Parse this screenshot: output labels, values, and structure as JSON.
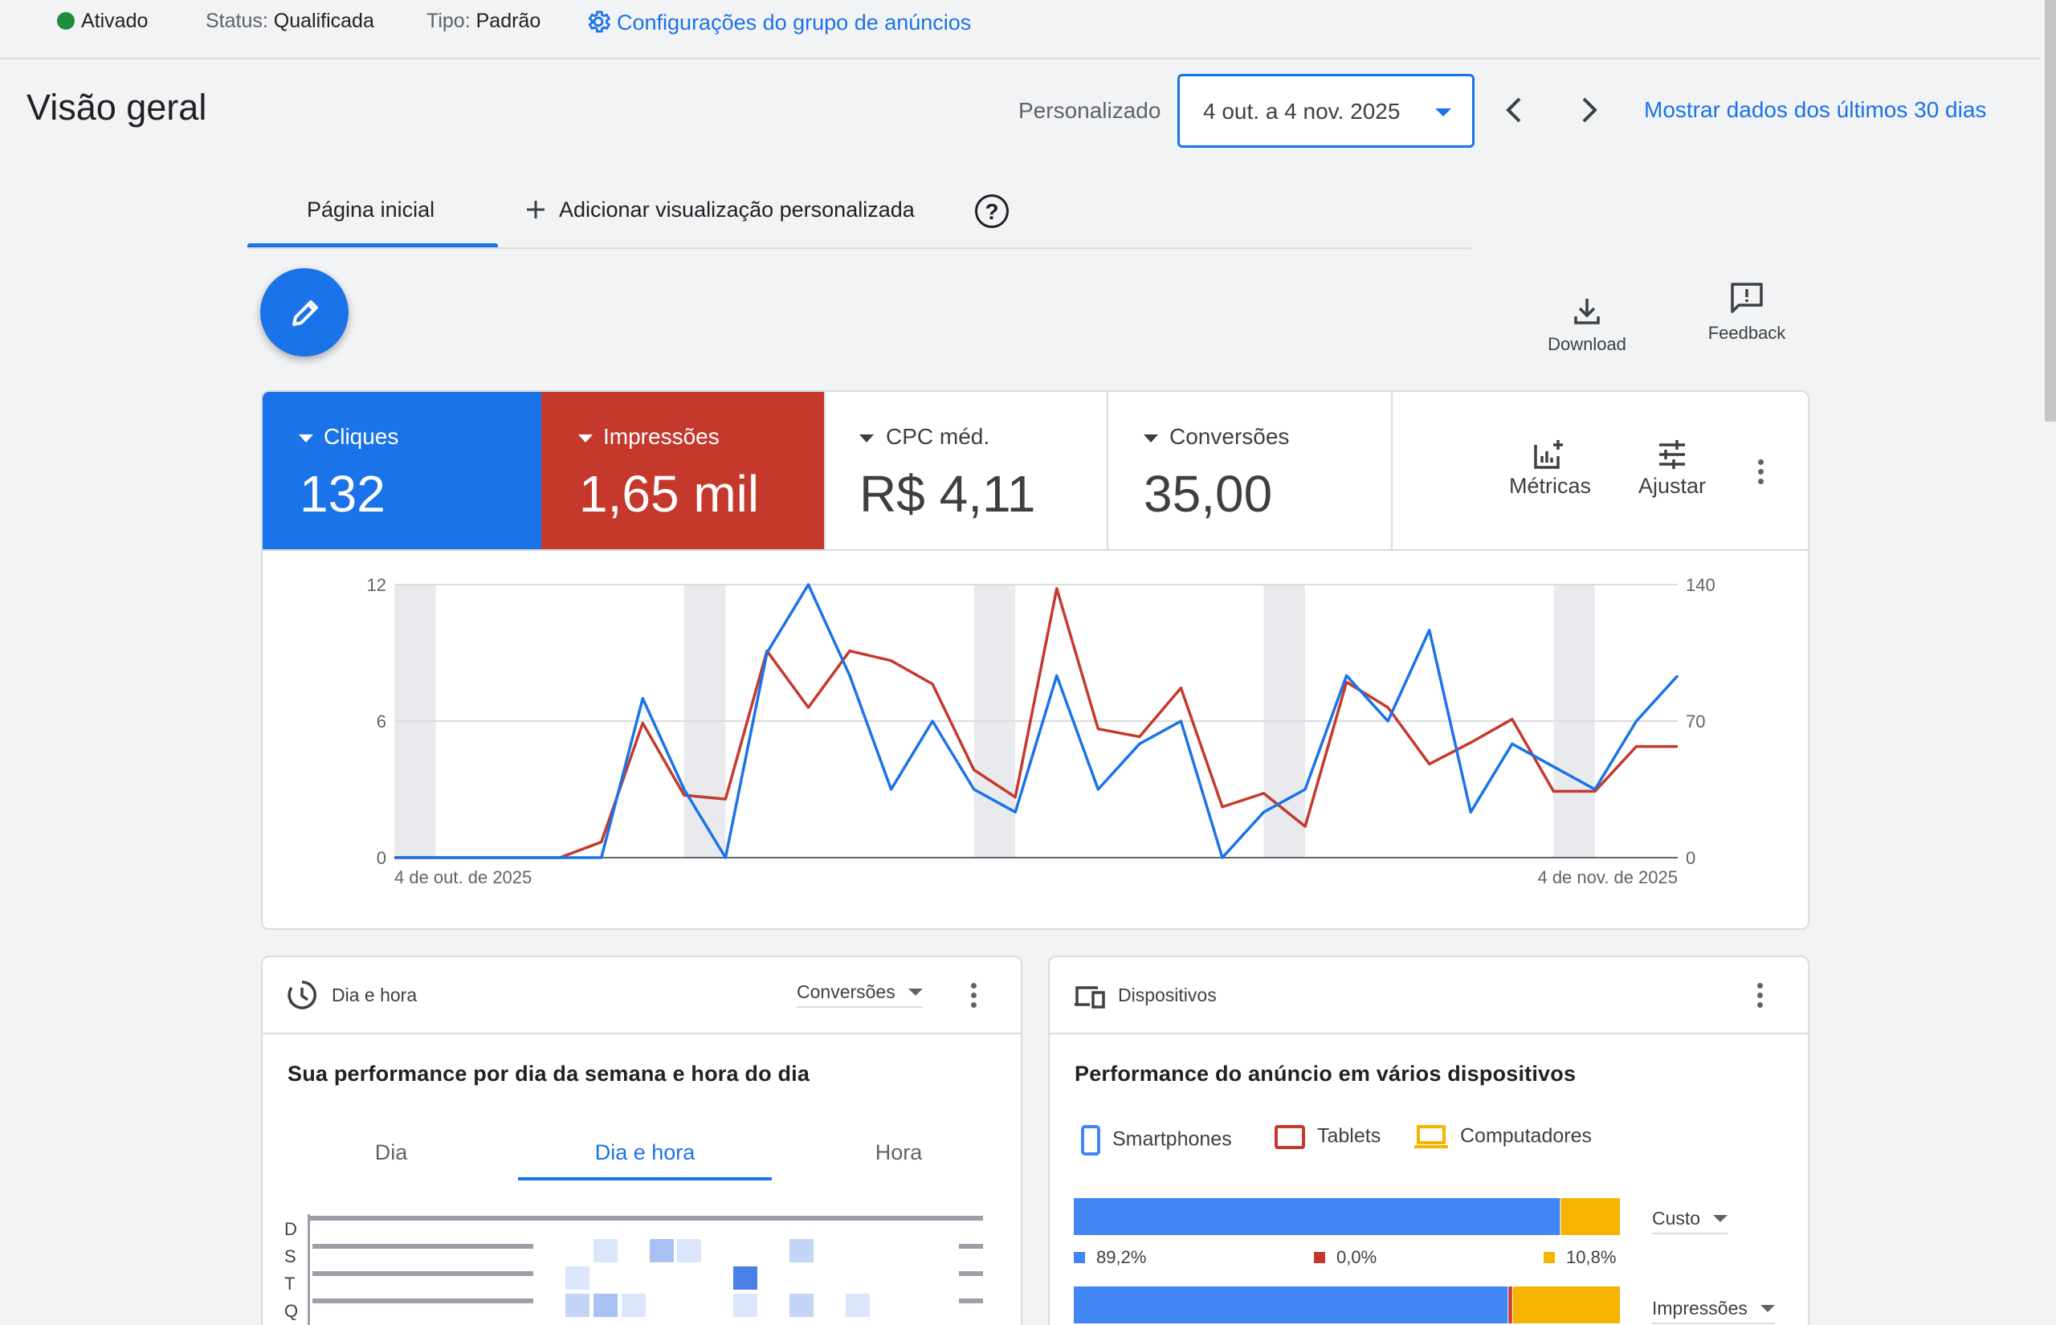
{
  "status_bar": {
    "state": "Ativado",
    "status_label": "Status:",
    "status_value": "Qualificada",
    "type_label": "Tipo:",
    "type_value": "Padrão",
    "settings_link": "Configurações do grupo de anúncios",
    "colors": {
      "active_dot": "#1e8e3e",
      "link": "#1a73e8"
    }
  },
  "header": {
    "title": "Visão geral",
    "period_label": "Personalizado",
    "date_range": "4 out. a 4 nov. 2025",
    "show_last_30": "Mostrar dados dos últimos 30 dias"
  },
  "tabs": [
    {
      "label": "Página inicial",
      "active": true
    },
    {
      "label": "Adicionar visualização personalizada",
      "icon": "plus-icon"
    }
  ],
  "toolbar": {
    "download_label": "Download",
    "feedback_label": "Feedback"
  },
  "metrics": [
    {
      "name": "Cliques",
      "value": "132",
      "selected": true,
      "color": "#1a73e8"
    },
    {
      "name": "Impressões",
      "value": "1,65 mil",
      "selected": true,
      "color": "#c5392c"
    },
    {
      "name": "CPC méd.",
      "value": "R$ 4,11",
      "selected": false
    },
    {
      "name": "Conversões",
      "value": "35,00",
      "selected": false
    }
  ],
  "metric_actions": {
    "metrics_label": "Métricas",
    "adjust_label": "Ajustar"
  },
  "chart_data": {
    "type": "line",
    "x_start_label": "4 de out. de 2025",
    "x_end_label": "4 de nov. de 2025",
    "y_left": {
      "ticks": [
        "12",
        "6",
        "0"
      ],
      "ylim": [
        0,
        12
      ]
    },
    "y_right": {
      "ticks": [
        "140",
        "70",
        "0"
      ],
      "ylim": [
        0,
        140
      ]
    },
    "weekend_bands_day_index": [
      0,
      7,
      14,
      21,
      28
    ],
    "grid": true,
    "series": [
      {
        "axis": "left",
        "color": "#1a73e8",
        "values": [
          0,
          0,
          0,
          0,
          0,
          0,
          7,
          3,
          0,
          9,
          12,
          8,
          3,
          6,
          3,
          2,
          8,
          3,
          5,
          6,
          0,
          2,
          3,
          8,
          6,
          10,
          2,
          5,
          4,
          3,
          6,
          8
        ]
      },
      {
        "axis": "right",
        "color": "#c5392c",
        "values": [
          0,
          0,
          0,
          0,
          0,
          8,
          69,
          32,
          30,
          106,
          77,
          106,
          101,
          89,
          45,
          31,
          138,
          66,
          62,
          87,
          26,
          33,
          16,
          90,
          77,
          48,
          59,
          71,
          34,
          34,
          57,
          57
        ]
      }
    ]
  },
  "day_hour_card": {
    "title": "Dia e hora",
    "metric_select": "Conversões",
    "subtitle": "Sua performance por dia da semana e hora do dia",
    "segments": [
      "Dia",
      "Dia e hora",
      "Hora"
    ],
    "active_segment": "Dia e hora",
    "row_labels": [
      "D",
      "S",
      "T",
      "Q"
    ]
  },
  "devices_card": {
    "title": "Dispositivos",
    "subtitle": "Performance do anúncio em vários dispositivos",
    "legend": [
      {
        "name": "Smartphones",
        "color": "#4285f4",
        "icon": "smartphone-icon"
      },
      {
        "name": "Tablets",
        "color": "#c5392c",
        "icon": "tablet-icon"
      },
      {
        "name": "Computadores",
        "color": "#f4b400",
        "icon": "laptop-icon"
      }
    ],
    "bars": [
      {
        "metric": "Custo",
        "shares": [
          89.2,
          0.0,
          10.8
        ],
        "labels": [
          "89,2%",
          "0,0%",
          "10,8%"
        ]
      },
      {
        "metric": "Impressões",
        "shares": [
          79.6,
          0.8,
          19.6
        ]
      }
    ]
  }
}
